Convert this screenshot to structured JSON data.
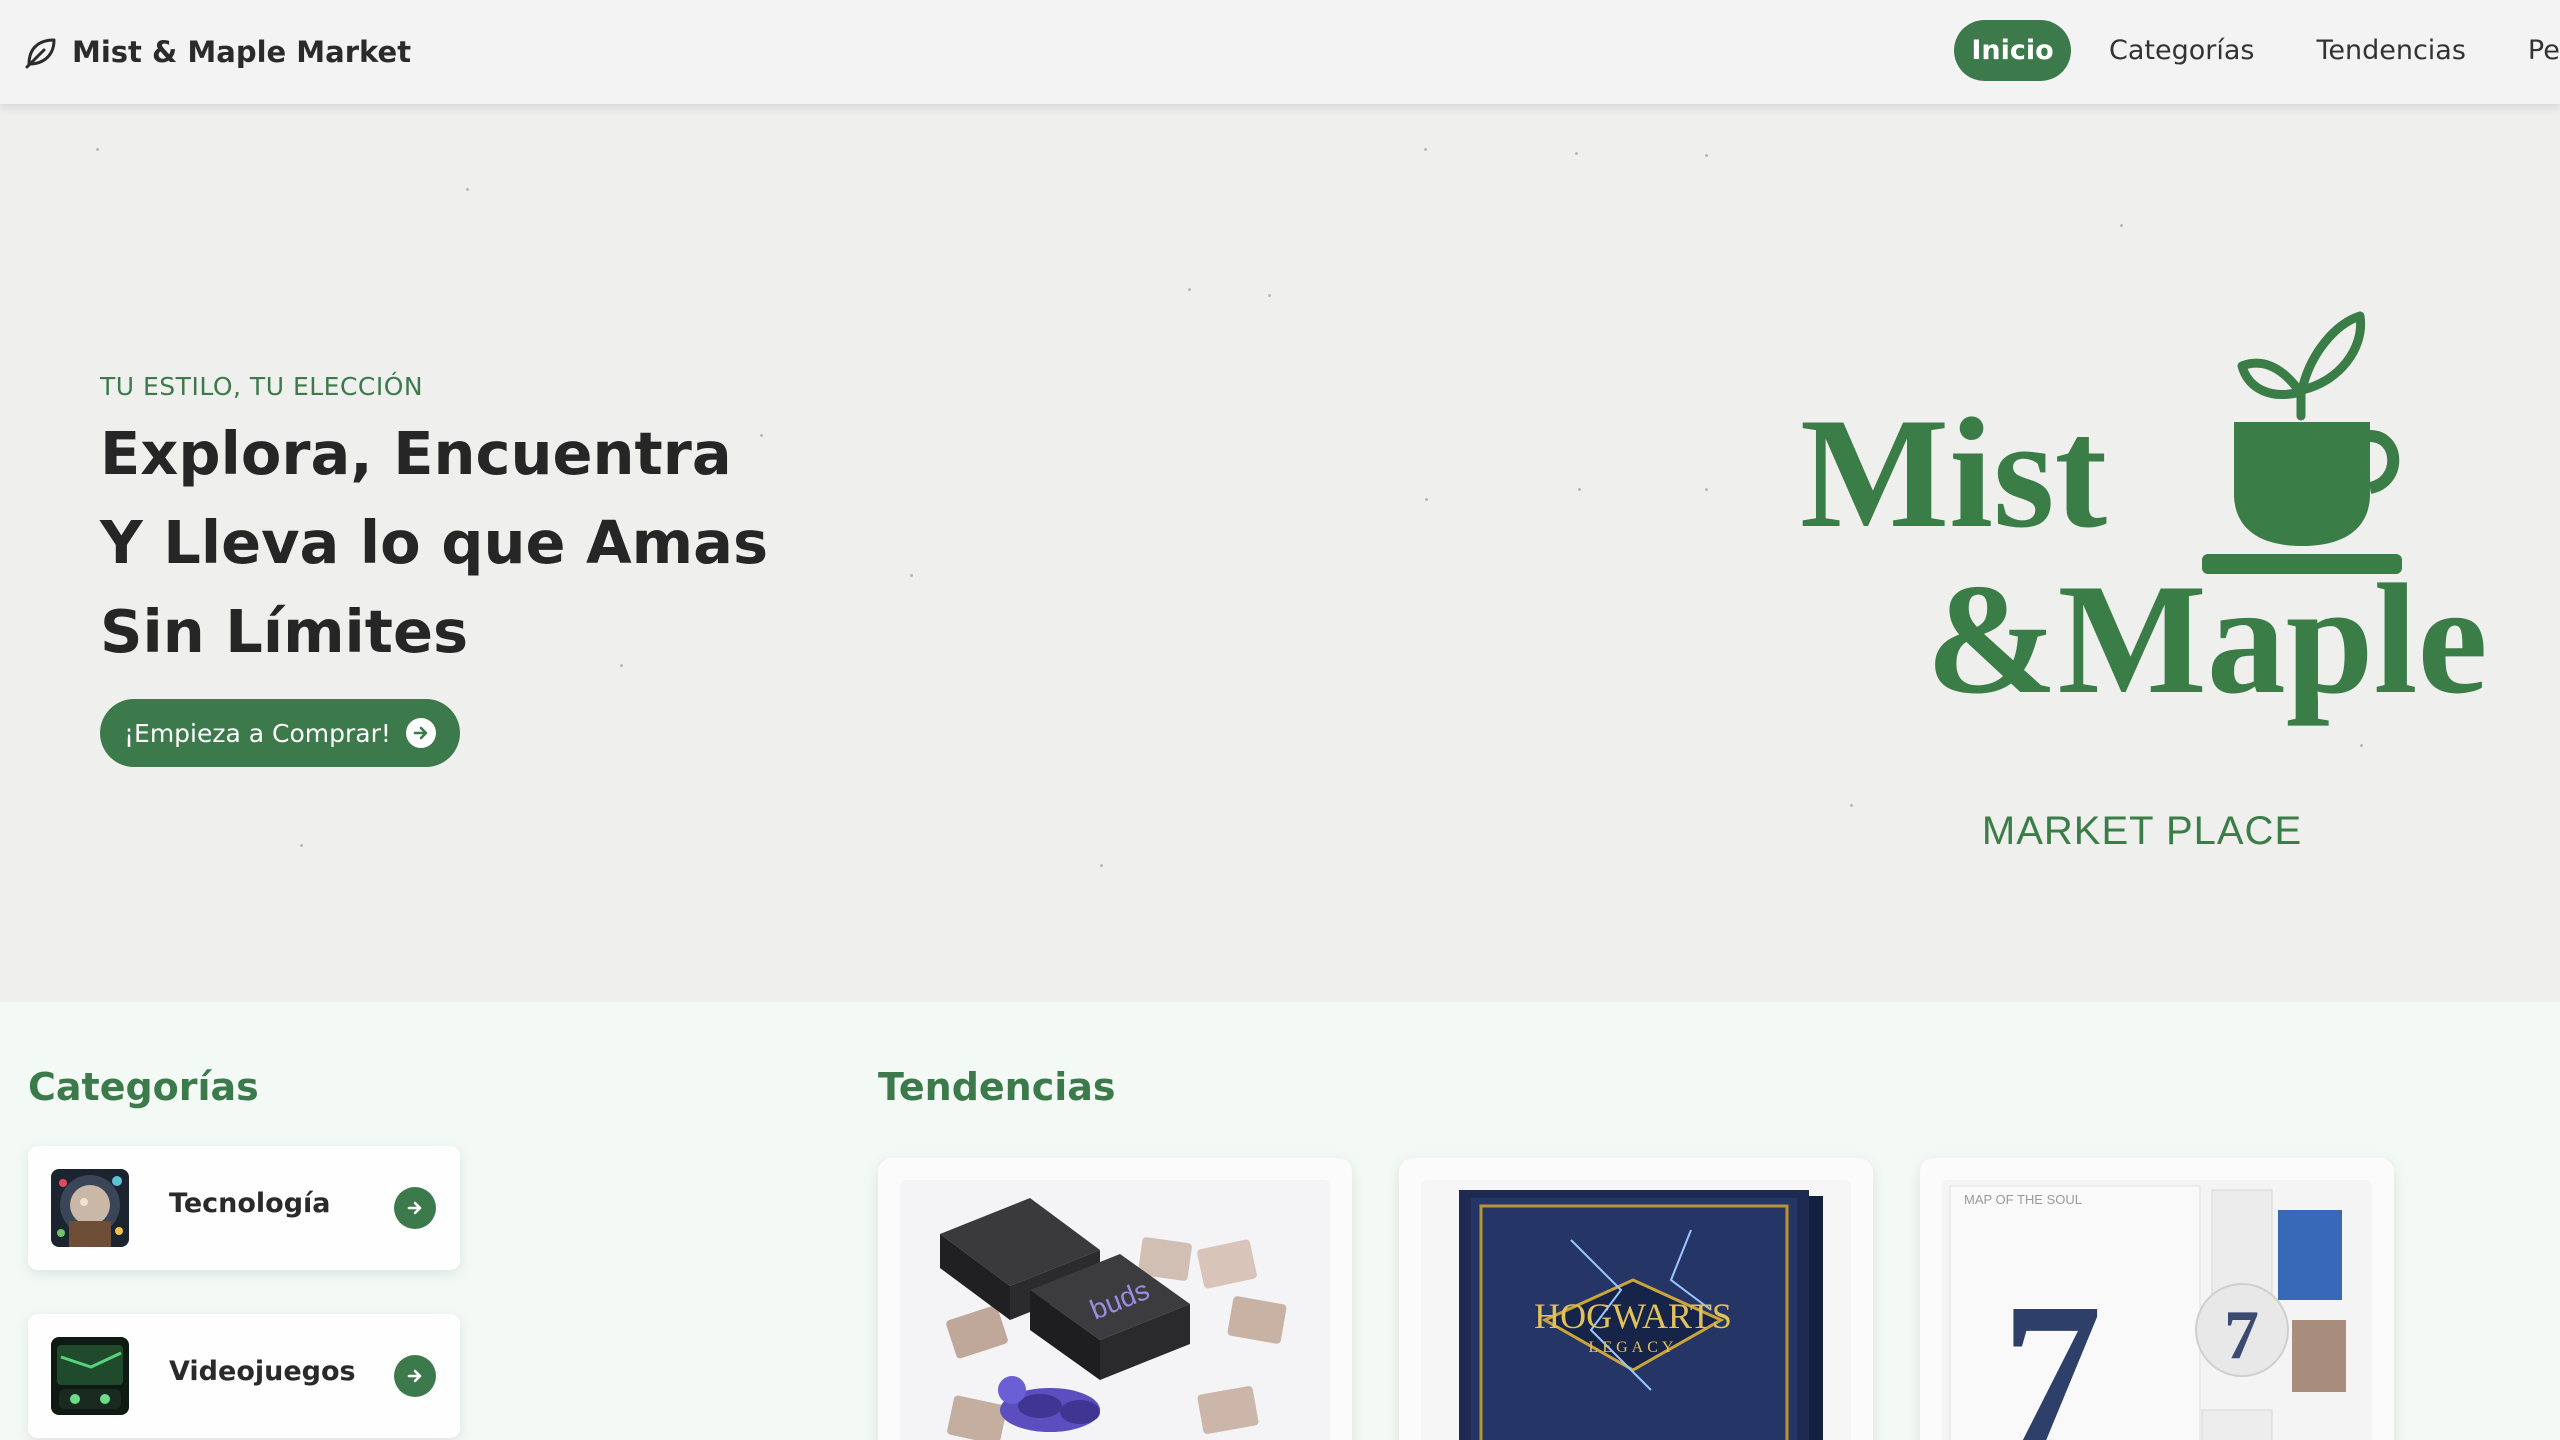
{
  "brand": {
    "name": "Mist & Maple Market",
    "icon": "leaf-icon"
  },
  "nav": {
    "items": [
      {
        "label": "Inicio",
        "active": true
      },
      {
        "label": "Categorías",
        "active": false
      },
      {
        "label": "Tendencias",
        "active": false
      },
      {
        "label": "Per",
        "active": false
      }
    ]
  },
  "hero": {
    "eyebrow": "TU ESTILO, TU ELECCIÓN",
    "headline": [
      "Explora, Encuentra",
      "Y Lleva lo que Amas",
      "Sin Límites"
    ],
    "cta_label": "¡Empieza a Comprar!",
    "cta_icon": "arrow-right-circle-icon",
    "logo": {
      "line1": "Mist",
      "line2": "&Maple",
      "subtitle": "MARKET PLACE",
      "icon": "teacup-with-leaves-icon"
    }
  },
  "categories": {
    "title": "Categorías",
    "items": [
      {
        "label": "Tecnología",
        "icon": "arrow-right-icon"
      },
      {
        "label": "Videojuegos",
        "icon": "arrow-right-icon"
      }
    ]
  },
  "trends": {
    "title": "Tendencias",
    "items": [
      {
        "text": "buds"
      },
      {
        "text": "HOGWARTS",
        "subtext": "LEGACY"
      },
      {
        "text": "7",
        "caption": "MAP OF THE SOUL"
      }
    ]
  },
  "colors": {
    "accent": "#3c7a4b",
    "navbar_bg": "#f3f3f3",
    "hero_bg": "#efefee",
    "page_bg": "#f3faf6",
    "text": "#262626"
  }
}
